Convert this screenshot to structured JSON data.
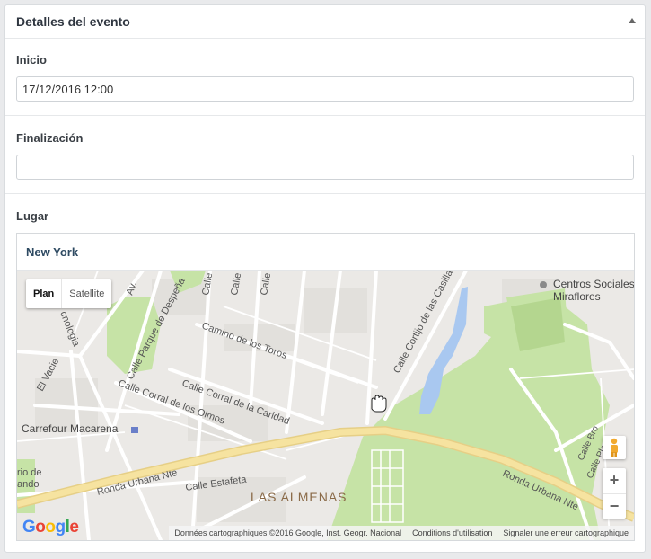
{
  "panel": {
    "title": "Detalles del evento"
  },
  "fields": {
    "inicio": {
      "label": "Inicio",
      "value": "17/12/2016 12:00"
    },
    "finalizacion": {
      "label": "Finalización",
      "value": ""
    },
    "lugar": {
      "label": "Lugar",
      "location": "New York"
    }
  },
  "map": {
    "type_buttons": {
      "plan": "Plan",
      "satellite": "Satellite"
    },
    "labels": {
      "centros": "Centros Sociales de",
      "miraflores": "Miraflores",
      "camino_toros": "Camino de los Toros",
      "calle_corral_caridad": "Calle Corral de la Caridad",
      "calle_corral_olmos": "Calle Corral de los Olmos",
      "calle_parque": "Calle Parque de Despeña",
      "calle_cortijo": "Calle Cortijo de las Casilla",
      "carrefour": "Carrefour Macarena",
      "ronda_left": "Ronda Urbana Nte",
      "ronda_right": "Ronda Urbana Nte",
      "calle_estafeta": "Calle Estafeta",
      "las_almenas": "LAS ALMENAS",
      "el_vacie": "El Vacie",
      "cnologia": "cnologia",
      "rio_de": "rio de",
      "ando": "ando",
      "av": "Av.",
      "calle_c1": "Calle",
      "calle_c2": "Calle",
      "calle_c3": "Calle",
      "calle_bro": "Calle Bro",
      "calle_pla": "Calle Pla"
    },
    "zoom": {
      "in": "+",
      "out": "−"
    },
    "logo": {
      "G": "G",
      "o1": "o",
      "o2": "o",
      "g": "g",
      "l": "l",
      "e": "e"
    },
    "attribution": {
      "data": "Données cartographiques ©2016 Google, Inst. Geogr. Nacional",
      "terms": "Conditions d'utilisation",
      "report": "Signaler une erreur cartographique"
    },
    "colors": {
      "park": "#c6e3a6",
      "water": "#a9c8f0",
      "highway": "#f6e3a0",
      "road": "#ffffff",
      "background": "#ebe9e6"
    }
  }
}
